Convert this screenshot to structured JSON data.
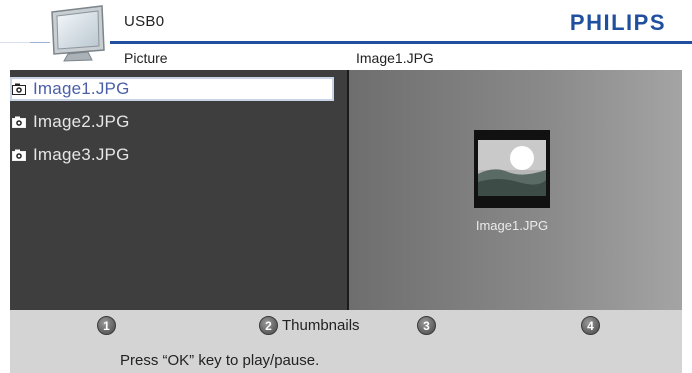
{
  "header": {
    "source_title": "USB0",
    "brand": "PHILIPS",
    "category": "Picture",
    "current_file": "Image1.JPG"
  },
  "file_list": [
    {
      "name": "Image1.JPG",
      "icon": "camera-icon",
      "selected": true
    },
    {
      "name": "Image2.JPG",
      "icon": "camera-icon",
      "selected": false
    },
    {
      "name": "Image3.JPG",
      "icon": "camera-icon",
      "selected": false
    }
  ],
  "preview": {
    "caption": "Image1.JPG",
    "icon": "image-thumbnail-icon"
  },
  "footer": {
    "buttons": [
      {
        "number": "1",
        "label": ""
      },
      {
        "number": "2",
        "label": "Thumbnails"
      },
      {
        "number": "3",
        "label": ""
      },
      {
        "number": "4",
        "label": ""
      }
    ],
    "hint": "Press “OK” key to play/pause."
  },
  "colors": {
    "brand": "#1f4f9e",
    "selected_text": "#4a5fa8",
    "list_bg": "#3e3e3e",
    "footer_bg": "#d4d4d4"
  }
}
